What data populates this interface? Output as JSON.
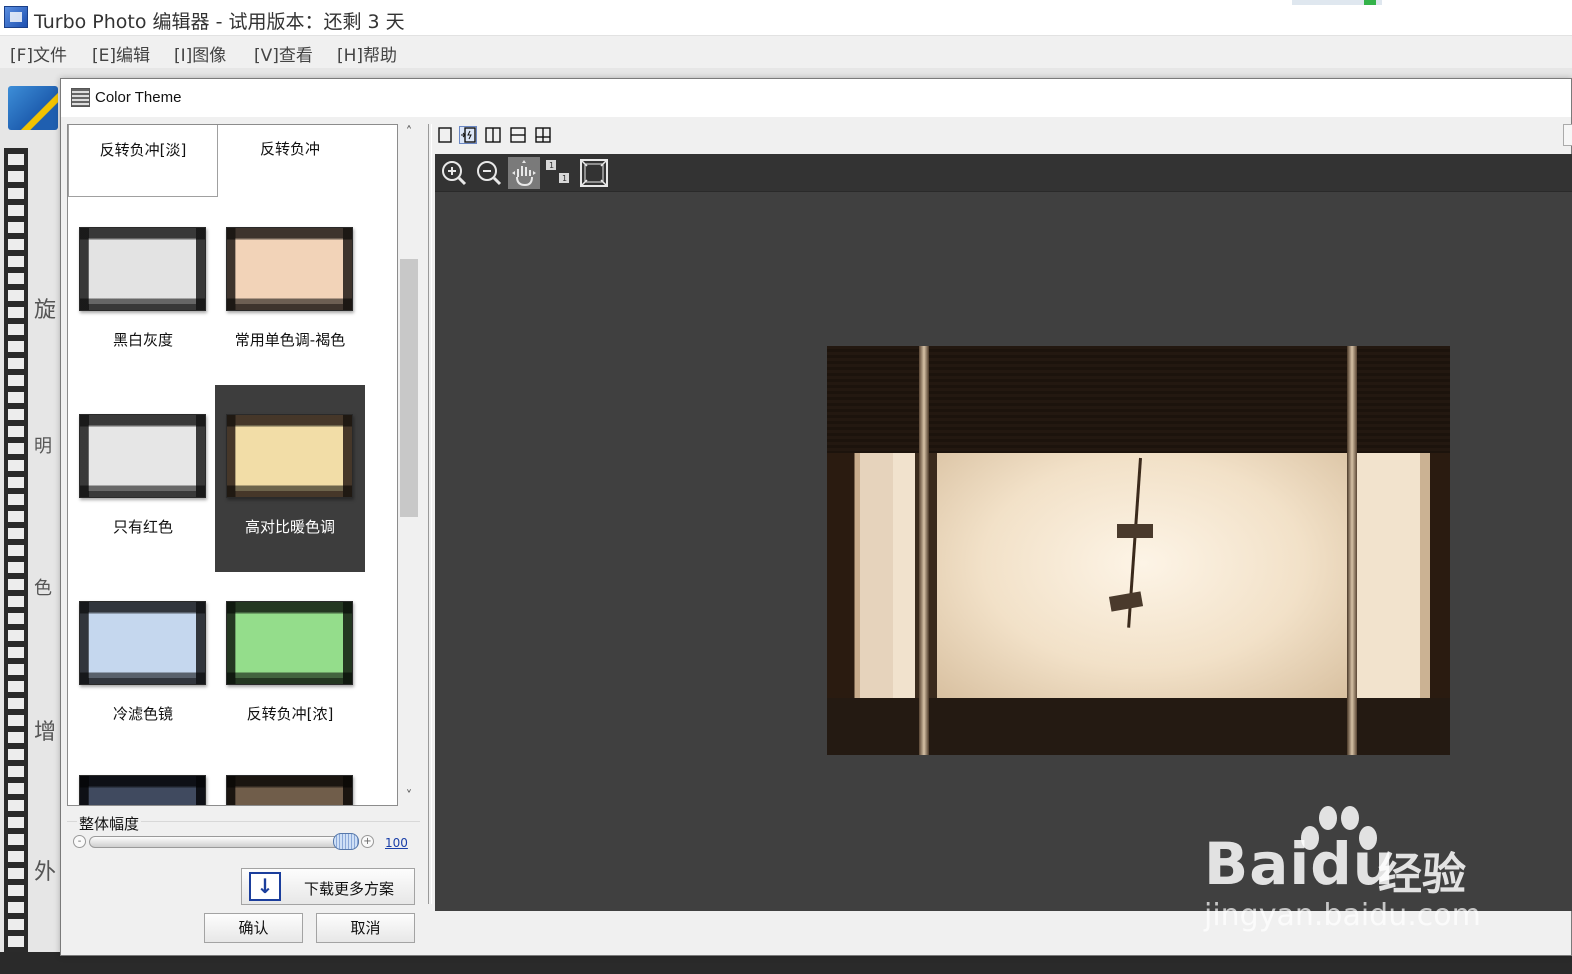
{
  "app": {
    "title": "Turbo Photo 编辑器 - 试用版本：还剩 3 天",
    "menu": [
      "[F]文件",
      "[E]编辑",
      "[I]图像",
      "[V]查看",
      "[H]帮助"
    ],
    "side_labels": [
      "旋",
      "明",
      "色",
      "增",
      "外"
    ]
  },
  "dialog": {
    "title": "Color Theme",
    "themes": [
      {
        "label": "反转负冲[淡]",
        "state": "outlined",
        "thumbnail": false,
        "tint": "#8a8a8a"
      },
      {
        "label": "反转负冲",
        "state": "normal",
        "thumbnail": false,
        "tint": "#8a8a8a"
      },
      {
        "label": "黑白灰度",
        "state": "normal",
        "thumbnail": true,
        "tint": "#7d7d7d"
      },
      {
        "label": "常用单色调-褐色",
        "state": "normal",
        "thumbnail": true,
        "tint": "#8a7464"
      },
      {
        "label": "只有红色",
        "state": "normal",
        "thumbnail": true,
        "tint": "#7f7f7f"
      },
      {
        "label": "高对比暖色调",
        "state": "selected",
        "thumbnail": true,
        "tint": "#9a7a5a"
      },
      {
        "label": "冷滤色镜",
        "state": "normal",
        "thumbnail": true,
        "tint": "#6c7684"
      },
      {
        "label": "反转负冲[浓]",
        "state": "normal",
        "thumbnail": true,
        "tint": "#4f7a4a"
      },
      {
        "label": "",
        "state": "partial",
        "thumbnail": true,
        "tint": "#1e2430"
      },
      {
        "label": "",
        "state": "partial",
        "thumbnail": true,
        "tint": "#3a2f24"
      }
    ],
    "amplitude": {
      "label": "整体幅度",
      "value": "100",
      "level_percent": 100,
      "minus": "-",
      "plus": "+"
    },
    "download_button": "下载更多方案",
    "download_icon": "↓",
    "ok_button": "确认",
    "cancel_button": "取消",
    "scroll_up": "˄",
    "scroll_down": "˅",
    "view_modes": [
      "single-view-icon",
      "before-after-icon",
      "split-vertical-icon",
      "split-horizontal-icon",
      "compare-quad-icon"
    ],
    "active_view_mode": 1,
    "preview_tools": [
      "zoom-in-icon",
      "zoom-out-icon",
      "pan-hand-icon",
      "actual-size-icon",
      "fit-window-icon"
    ],
    "active_preview_tool": 2
  },
  "watermark": {
    "brand_latin": "Bai",
    "brand_du": "du",
    "brand_cn": "经验",
    "url": "jingyan.baidu.com"
  }
}
